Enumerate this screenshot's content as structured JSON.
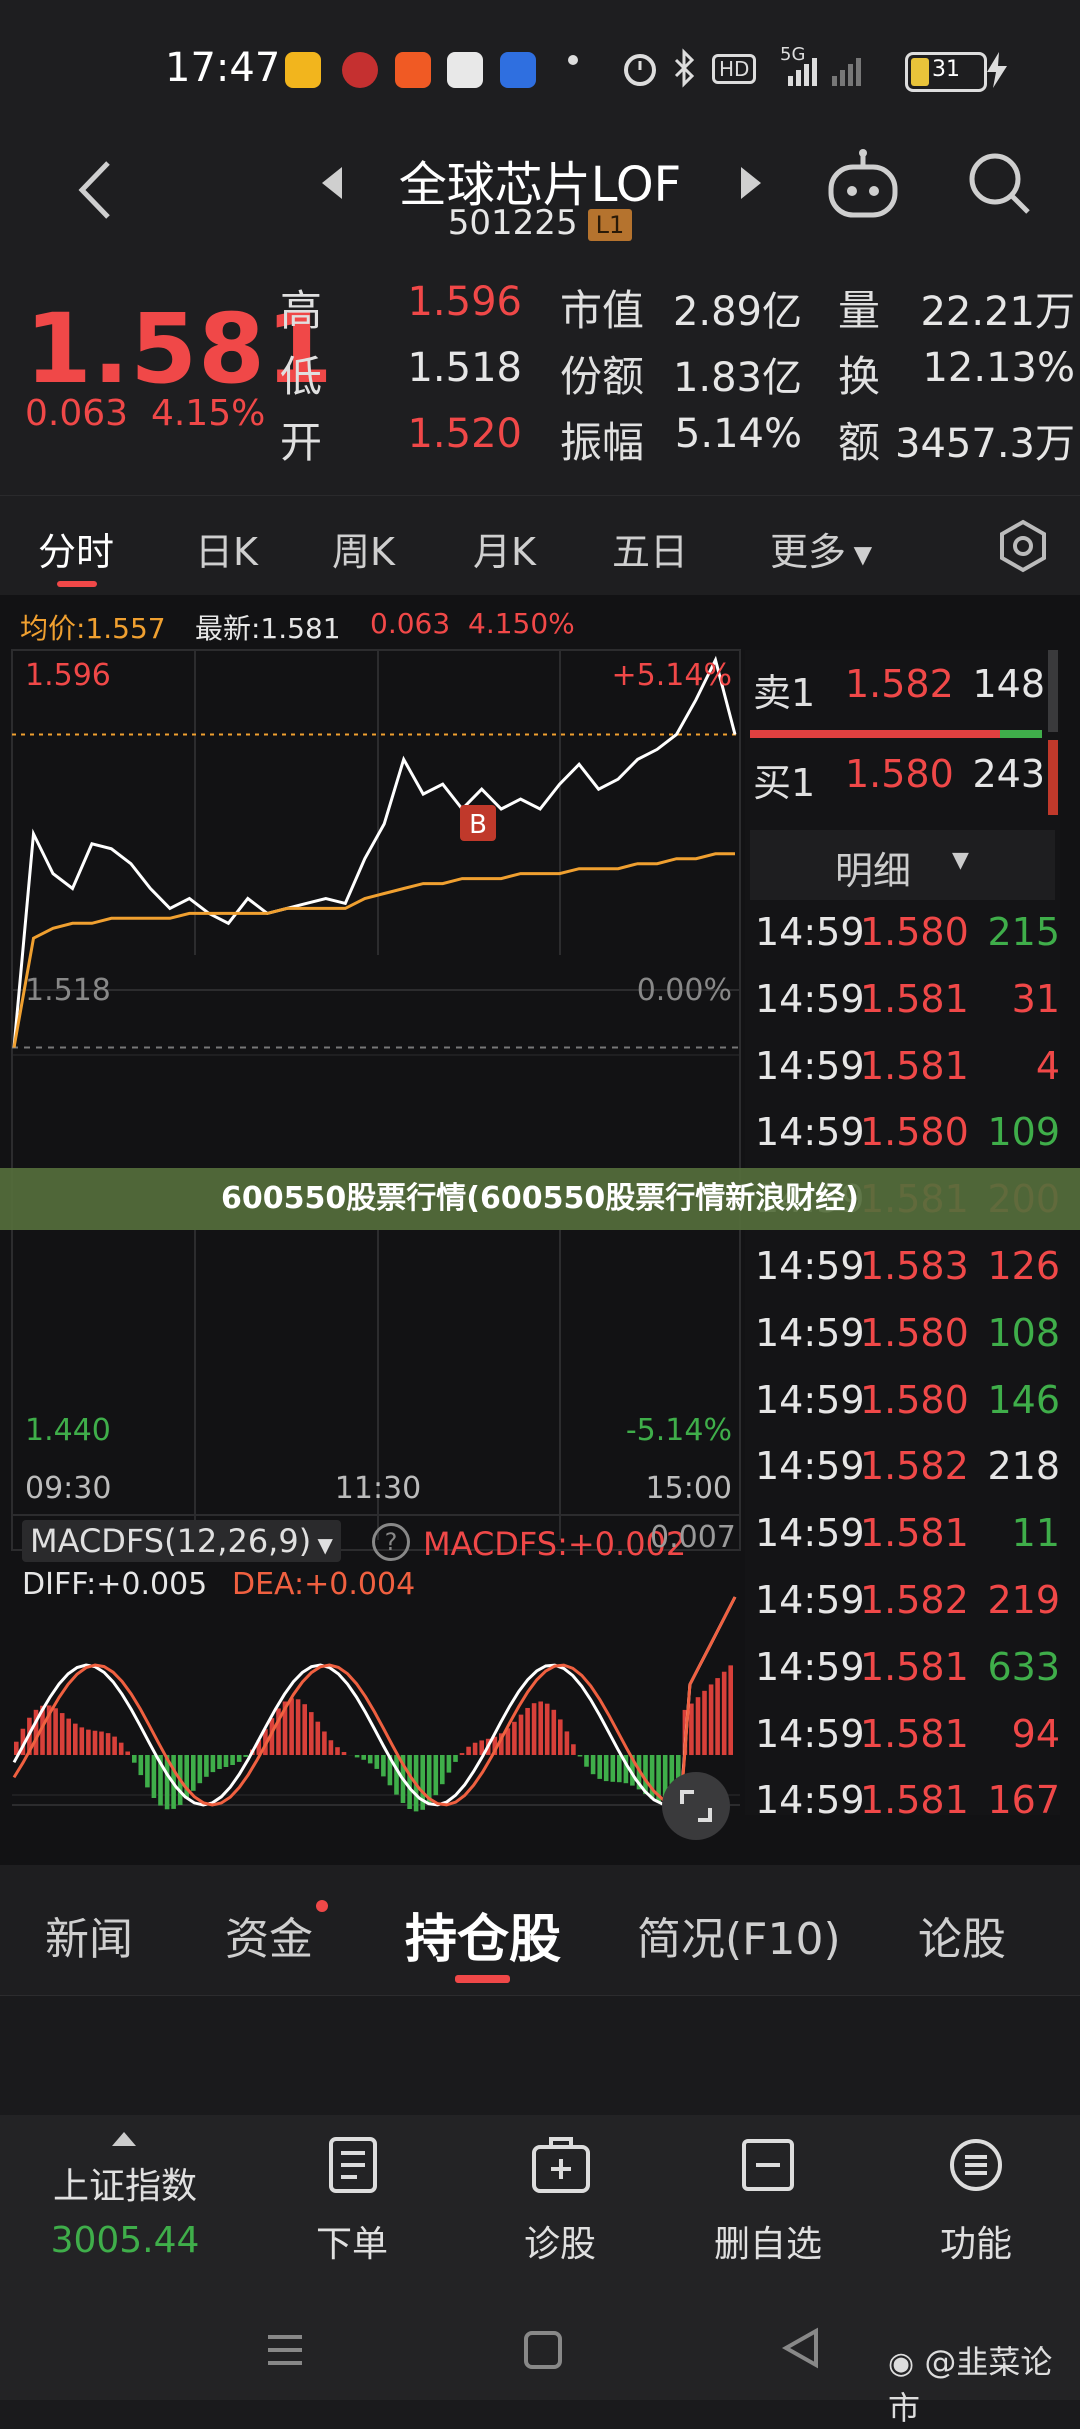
{
  "status": {
    "time": "17:47",
    "battery": "31",
    "net_5g": "5G",
    "hd": "HD"
  },
  "nav": {
    "title": "全球芯片LOF",
    "code": "501225",
    "level_badge": "L1"
  },
  "quote": {
    "price": "1.581",
    "change": "0.063",
    "change_pct": "4.15%",
    "labels": {
      "high": "高",
      "low": "低",
      "open": "开",
      "mcap": "市值",
      "shares": "份额",
      "amplitude": "振幅",
      "volume": "量",
      "turnover_rate": "换",
      "amount": "额"
    },
    "values": {
      "high": "1.596",
      "low": "1.518",
      "open": "1.520",
      "mcap": "2.89亿",
      "shares": "1.83亿",
      "amplitude": "5.14%",
      "volume": "22.21万",
      "turnover_rate": "12.13%",
      "amount": "3457.3万"
    }
  },
  "tabs": [
    "分时",
    "日K",
    "周K",
    "月K",
    "五日",
    "更多"
  ],
  "chart_info": {
    "avg_label": "均价:1.557",
    "latest_label": "最新:1.581",
    "change": "0.063",
    "change_pct": "4.150%"
  },
  "chart_data": {
    "type": "line",
    "y_top_price": "1.596",
    "y_mid_price": "1.518",
    "y_bottom_price": "1.440",
    "y_top_pct": "+5.14%",
    "y_mid_pct": "0.00%",
    "y_bottom_pct": "-5.14%",
    "ylim": [
      1.44,
      1.596
    ],
    "x_ticks": [
      "09:30",
      "11:30",
      "15:00"
    ],
    "marker": "B",
    "series": [
      {
        "name": "price",
        "color": "#ffffff",
        "values": [
          1.518,
          1.561,
          1.553,
          1.55,
          1.559,
          1.558,
          1.555,
          1.55,
          1.546,
          1.548,
          1.545,
          1.543,
          1.548,
          1.545,
          1.546,
          1.547,
          1.548,
          1.547,
          1.556,
          1.563,
          1.576,
          1.569,
          1.571,
          1.566,
          1.57,
          1.566,
          1.568,
          1.566,
          1.571,
          1.575,
          1.57,
          1.572,
          1.576,
          1.578,
          1.581,
          1.588,
          1.596,
          1.581
        ]
      },
      {
        "name": "avg",
        "color": "#f0a030",
        "values": [
          1.518,
          1.54,
          1.542,
          1.543,
          1.543,
          1.544,
          1.544,
          1.544,
          1.544,
          1.545,
          1.545,
          1.545,
          1.545,
          1.545,
          1.546,
          1.546,
          1.546,
          1.546,
          1.548,
          1.549,
          1.55,
          1.551,
          1.551,
          1.552,
          1.552,
          1.552,
          1.553,
          1.553,
          1.553,
          1.554,
          1.554,
          1.554,
          1.555,
          1.555,
          1.556,
          1.556,
          1.557,
          1.557
        ]
      }
    ]
  },
  "macd": {
    "label": "MACDFS(12,26,9)",
    "value_label": "MACDFS:+0.002",
    "diff_label": "DIFF:+0.005",
    "dea_label": "DEA:+0.004",
    "right_value": "0.007"
  },
  "order_book": {
    "sell": {
      "label": "卖1",
      "price": "1.582",
      "volume": "148"
    },
    "buy": {
      "label": "买1",
      "price": "1.580",
      "volume": "243"
    },
    "detail_title": "明细",
    "details": [
      {
        "time": "14:59",
        "price": "1.580",
        "vol": "215",
        "vc": "green"
      },
      {
        "time": "14:59",
        "price": "1.581",
        "vol": "31",
        "vc": "red"
      },
      {
        "time": "14:59",
        "price": "1.581",
        "vol": "4",
        "vc": "red"
      },
      {
        "time": "14:59",
        "price": "1.580",
        "vol": "109",
        "vc": "green"
      },
      {
        "time": "14:59",
        "price": "1.581",
        "vol": "200",
        "vc": "red"
      },
      {
        "time": "14:59",
        "price": "1.583",
        "vol": "126",
        "vc": "red"
      },
      {
        "time": "14:59",
        "price": "1.580",
        "vol": "108",
        "vc": "green"
      },
      {
        "time": "14:59",
        "price": "1.580",
        "vol": "146",
        "vc": "green"
      },
      {
        "time": "14:59",
        "price": "1.582",
        "vol": "218",
        "vc": "white"
      },
      {
        "time": "14:59",
        "price": "1.581",
        "vol": "11",
        "vc": "green"
      },
      {
        "time": "14:59",
        "price": "1.582",
        "vol": "219",
        "vc": "red"
      },
      {
        "time": "14:59",
        "price": "1.581",
        "vol": "633",
        "vc": "green"
      },
      {
        "time": "14:59",
        "price": "1.581",
        "vol": "94",
        "vc": "red"
      },
      {
        "time": "14:59",
        "price": "1.581",
        "vol": "167",
        "vc": "red"
      }
    ]
  },
  "banner": "600550股票行情(600550股票行情新浪财经)",
  "news_tabs": [
    "新闻",
    "资金",
    "持仓股",
    "简况(F10)",
    "论股"
  ],
  "bottom": {
    "index_name": "上证指数",
    "index_value": "3005.44",
    "items": [
      "下单",
      "诊股",
      "删自选",
      "功能"
    ]
  },
  "watermark": "@韭菜论市"
}
